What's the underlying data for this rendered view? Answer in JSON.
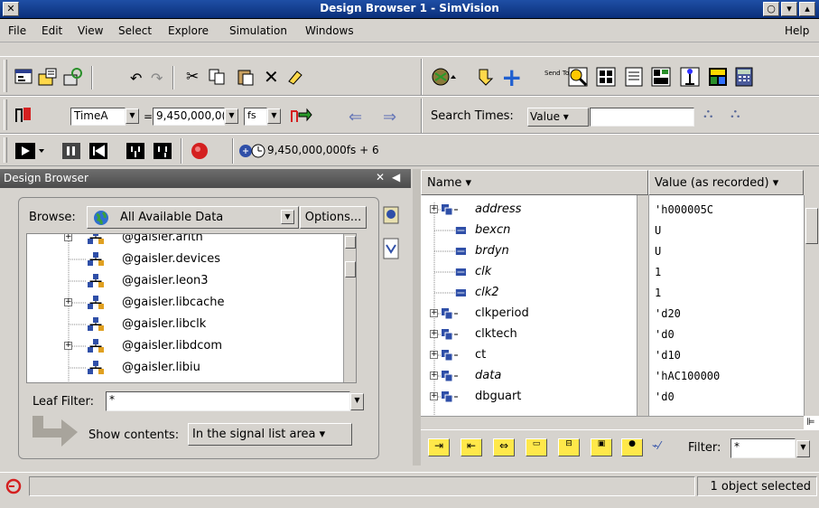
{
  "window": {
    "title": "Design Browser 1 - SimVision"
  },
  "menubar": {
    "items": [
      "File",
      "Edit",
      "View",
      "Select",
      "Explore",
      "Simulation",
      "Windows"
    ],
    "help": "Help"
  },
  "toolbar2": {
    "time_name": "TimeA",
    "time_eq": "=",
    "time_value": "9,450,000,0(",
    "time_unit": "fs",
    "search_label": "Search Times:",
    "search_mode": "Value",
    "search_value": ""
  },
  "toolbar1": {
    "send_to_label": "Send To:"
  },
  "toolbar3": {
    "current_time": "9,450,000,000fs + 6"
  },
  "design_browser": {
    "header": "Design Browser",
    "browse_label": "Browse:",
    "browse_value": "All Available Data",
    "options_label": "Options...",
    "tree": [
      {
        "label": "@gaisler.arith",
        "expander": true
      },
      {
        "label": "@gaisler.devices",
        "expander": false
      },
      {
        "label": "@gaisler.leon3",
        "expander": false
      },
      {
        "label": "@gaisler.libcache",
        "expander": true
      },
      {
        "label": "@gaisler.libclk",
        "expander": false
      },
      {
        "label": "@gaisler.libdcom",
        "expander": true
      },
      {
        "label": "@gaisler.libiu",
        "expander": false
      }
    ],
    "leaf_filter_label": "Leaf Filter:",
    "leaf_filter_value": "*",
    "show_contents_label": "Show contents:",
    "show_contents_value": "In the signal list area"
  },
  "signal_list": {
    "col_name": "Name",
    "col_value": "Value (as recorded)",
    "rows": [
      {
        "name": "address",
        "value": "'h000005C",
        "italic": true,
        "expander": true
      },
      {
        "name": "bexcn",
        "value": "U",
        "italic": true,
        "expander": false
      },
      {
        "name": "brdyn",
        "value": "U",
        "italic": true,
        "expander": false
      },
      {
        "name": "clk",
        "value": "1",
        "italic": true,
        "expander": false
      },
      {
        "name": "clk2",
        "value": "1",
        "italic": true,
        "expander": false
      },
      {
        "name": "clkperiod",
        "value": "'d20",
        "italic": false,
        "expander": true
      },
      {
        "name": "clktech",
        "value": "'d0",
        "italic": false,
        "expander": true
      },
      {
        "name": "ct",
        "value": "'d10",
        "italic": false,
        "expander": true
      },
      {
        "name": "data",
        "value": "'hAC100000",
        "italic": true,
        "expander": true
      },
      {
        "name": "dbguart",
        "value": "'d0",
        "italic": false,
        "expander": true
      }
    ],
    "filter_label": "Filter:",
    "filter_value": "*"
  },
  "status": {
    "text": "1 object selected"
  },
  "colors": {
    "title_bg": "#0a2f7a",
    "panel_header": "#5a5a5a",
    "stop_red": "#d42020"
  }
}
